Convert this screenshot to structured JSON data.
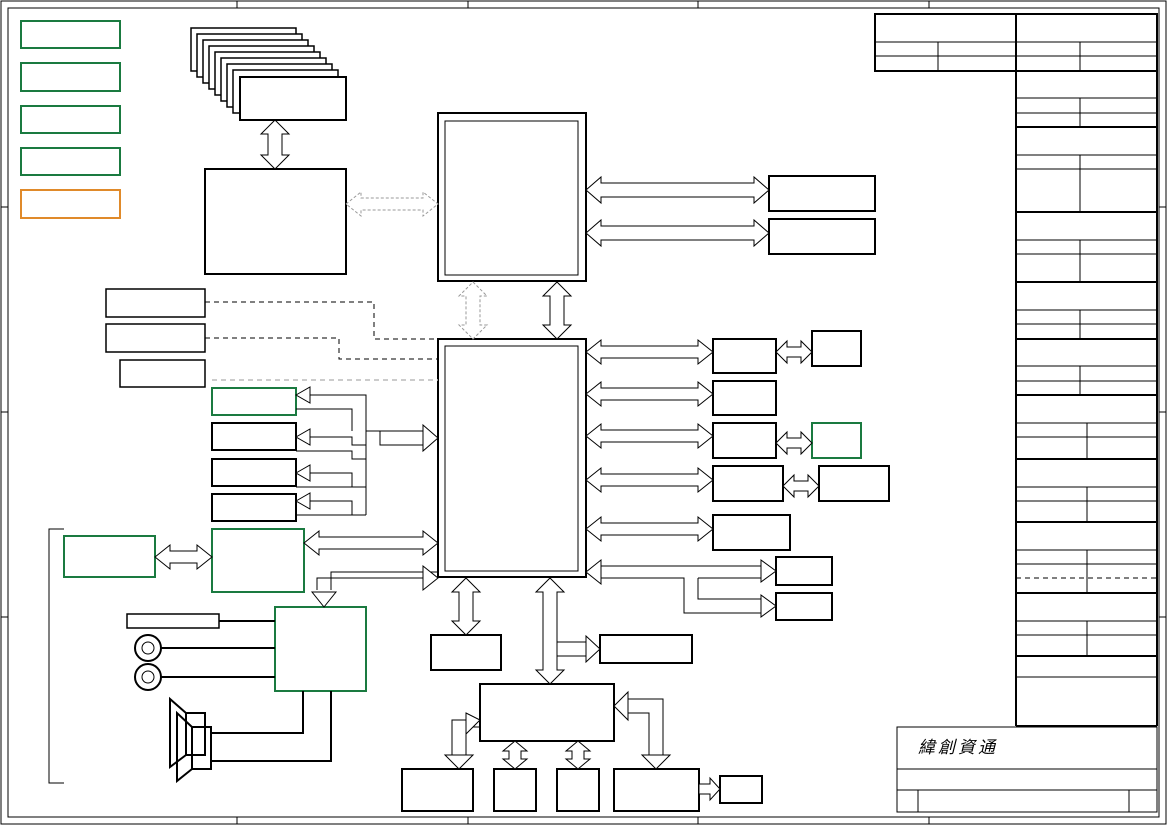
{
  "title_block": {
    "company_name": "緯創資通"
  },
  "colors": {
    "line": "#000000",
    "green": "#1a7a40",
    "orange": "#e08a2a",
    "dash": "#000000",
    "light_dash": "#bbbbbb"
  }
}
